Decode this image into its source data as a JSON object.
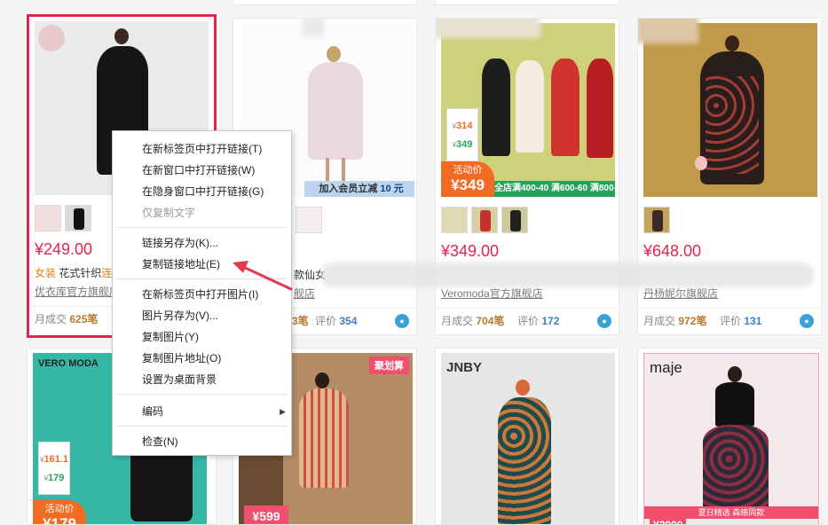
{
  "products": [
    {
      "price": "¥249.00",
      "title_pre": "女装",
      "title_mid": " 花式针织",
      "title_post": "连",
      "shop": "优衣库官方旗舰店",
      "sold_label": "月成交",
      "sold": "625笔"
    },
    {
      "title_pre": "",
      "title_post": "款仙女",
      "shop": "舰店",
      "sold": "3笔",
      "rev_label": "评价",
      "rev": "354",
      "vip": "加入会员立减",
      "vip_amt": "10 元"
    },
    {
      "price": "¥349.00",
      "shop": "Veromoda官方旗舰店",
      "sold_label": "月成交",
      "sold": "704笔",
      "rev_label": "评价",
      "rev": "172",
      "badge_top": "活动价",
      "badge_big": "349",
      "strip": "全店满400-40 满600-60 满800-80",
      "card_price1": "314",
      "card_price2": "349"
    },
    {
      "price": "¥648.00",
      "shop": "丹杨妮尔旗舰店",
      "sold_label": "月成交",
      "sold": "972笔",
      "rev_label": "评价",
      "rev": "131"
    },
    {
      "brand": "VERO MODA",
      "badge_top": "活动价",
      "badge_big": "179",
      "card_price1": "161.1",
      "card_price2": "179"
    },
    {
      "red_tag": "聚划算",
      "price_tag": "599"
    },
    {
      "brand": "JNBY"
    },
    {
      "brand": "maje",
      "bottom_tag": "夏日精选 森络同款",
      "price_tag": "2900"
    }
  ],
  "context_menu": {
    "items": [
      {
        "label": "在新标签页中打开链接(T)"
      },
      {
        "label": "在新窗口中打开链接(W)"
      },
      {
        "label": "在隐身窗口中打开链接(G)"
      },
      {
        "label": "仅复制文字",
        "disabled": true
      },
      {
        "label": "链接另存为(K)..."
      },
      {
        "label": "复制链接地址(E)"
      },
      {
        "label": "在新标签页中打开图片(I)"
      },
      {
        "label": "图片另存为(V)..."
      },
      {
        "label": "复制图片(Y)"
      },
      {
        "label": "复制图片地址(O)"
      },
      {
        "label": "设置为桌面背景"
      },
      {
        "label": "编码",
        "submenu": true
      },
      {
        "label": "检查(N)"
      }
    ]
  },
  "colors": {
    "accent_red": "#e4234f",
    "arrow_red": "#e5394b",
    "link_blue": "#3b7fc4"
  }
}
